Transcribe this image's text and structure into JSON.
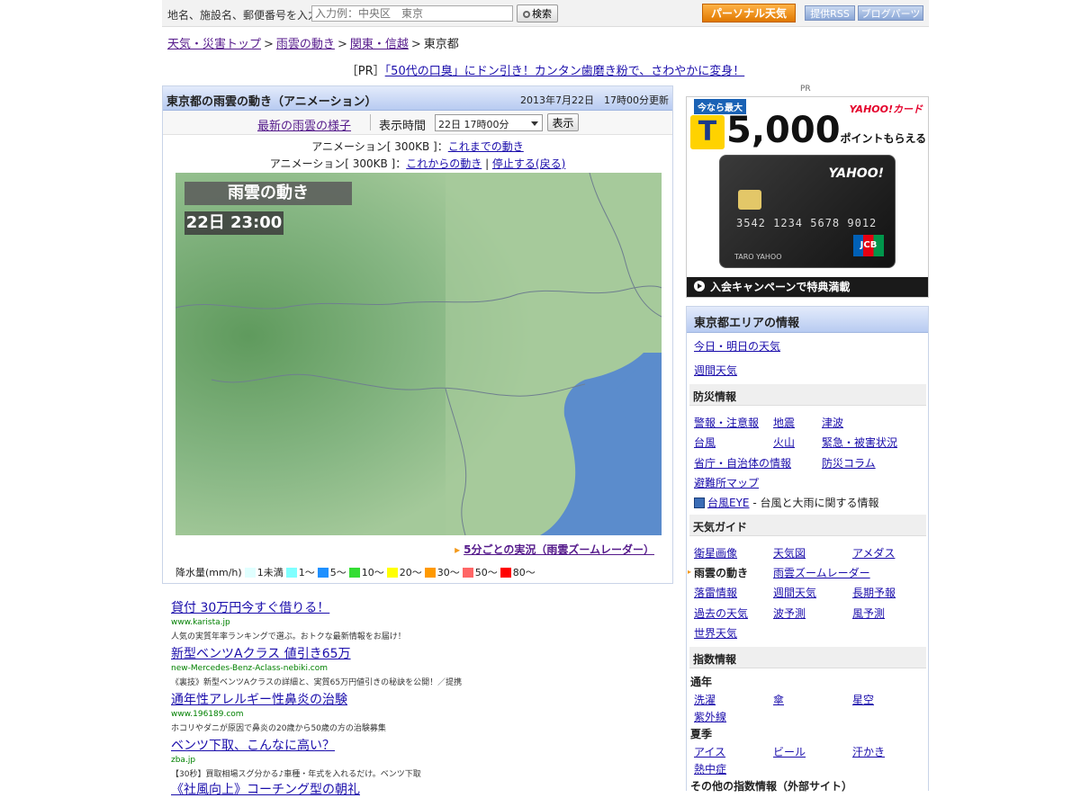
{
  "topbar": {
    "search_label": "地名、施設名、郵便番号を入力",
    "search_placeholder": "入力例：中央区　東京",
    "search_button": "検索",
    "personal_button": "パーソナル天気",
    "rss_button": "提供RSS",
    "blog_button": "ブログパーツ"
  },
  "breadcrumb": [
    "天気・災害トップ",
    "雨雲の動き",
    "関東・信越",
    "東京都"
  ],
  "pr_banner": {
    "prefix": "［PR］",
    "link": "「50代の口臭」にドン引き！カンタン歯磨き粉で、さわやかに変身！"
  },
  "main": {
    "title": "東京都の雨雲の動き（アニメーション）",
    "date": "2013年7月22日　17時00分更新",
    "latest_link": "最新の雨雲の様子",
    "time_label": "表示時間",
    "time_value": "22日 17時00分",
    "show_button": "表示",
    "anim1_prefix": "アニメーション[ 300KB ]：",
    "anim1_link": "これまでの動き",
    "anim2_prefix": "アニメーション[ 300KB ]：",
    "anim2_link": "これからの動き",
    "anim2_sep": " | ",
    "anim2_stop": "停止する(戻る)",
    "map_title": "雨雲の動き",
    "map_time": "22日 23:00",
    "zoom_link": "5分ごとの実況（雨雲ズームレーダー）",
    "legend_label": "降水量(mm/h)",
    "legend": [
      {
        "label": "1未満",
        "color": "#e0ffff"
      },
      {
        "label": "1～",
        "color": "#7fffff"
      },
      {
        "label": "5～",
        "color": "#1e90ff"
      },
      {
        "label": "10～",
        "color": "#33dd33"
      },
      {
        "label": "20～",
        "color": "#ffff00"
      },
      {
        "label": "30～",
        "color": "#ff9900"
      },
      {
        "label": "50～",
        "color": "#ff6666"
      },
      {
        "label": "80～",
        "color": "#ff0000"
      }
    ]
  },
  "ads": [
    {
      "title": "貸付 30万円今すぐ借りる！",
      "url": "www.karista.jp",
      "desc": "人気の実質年率ランキングで選ぶ。おトクな最新情報をお届け！"
    },
    {
      "title": "新型ベンツAクラス 値引き65万",
      "url": "new-Mercedes-Benz-Aclass-nebiki.com",
      "desc": "《裏技》新型ベンツAクラスの詳細と、実質65万円値引きの秘訣を公開！／提携"
    },
    {
      "title": "通年性アレルギー性鼻炎の治験",
      "url": "www.196189.com",
      "desc": "ホコリやダニが原因で鼻炎の20歳から50歳の方の治験募集"
    },
    {
      "title": "ベンツ下取、こんなに高い？",
      "url": "zba.jp",
      "desc": "【30秒】買取相場スグ分かる♪車種・年式を入れるだけ。ベンツ下取"
    },
    {
      "title": "《社風向上》コーチング型の朝礼",
      "url": "",
      "desc": ""
    }
  ],
  "right": {
    "pr_label": "PR",
    "card_ad": {
      "top_label": "今なら最大",
      "brand": "YAHOO!カード",
      "t_mark": "T",
      "points": "5,000",
      "points_suffix": "ポイントもらえる",
      "card_brand": "YAHOO!",
      "card_number": "3542 1234 5678 9012",
      "jcb": "JCB",
      "holder": "TARO YAHOO",
      "bottom": "入会キャンペーンで特典満載"
    },
    "area": {
      "header": "東京都エリアの情報",
      "links_top": [
        "今日・明日の天気",
        "週間天気"
      ],
      "sec_disaster": "防災情報",
      "disaster": [
        "警報・注意報",
        "地震",
        "津波",
        "台風",
        "火山",
        "緊急・被害状況",
        "省庁・自治体の情報",
        "防災コラム",
        "避難所マップ"
      ],
      "typhoon_link": "台風EYE",
      "typhoon_desc": " - 台風と大雨に関する情報",
      "sec_guide": "天気ガイド",
      "guide": [
        "衛星画像",
        "天気図",
        "アメダス",
        "雨雲の動き",
        "雨雲ズームレーダー",
        "落雷情報",
        "週間天気",
        "長期予報",
        "過去の天気",
        "波予測",
        "風予測",
        "世界天気"
      ],
      "sec_index": "指数情報",
      "sub_year": "通年",
      "year": [
        "洗濯",
        "傘",
        "星空",
        "紫外線"
      ],
      "sub_summer": "夏季",
      "summer": [
        "アイス",
        "ビール",
        "汗かき",
        "熱中症"
      ],
      "other": "その他の指数情報（外部サイト）"
    }
  }
}
